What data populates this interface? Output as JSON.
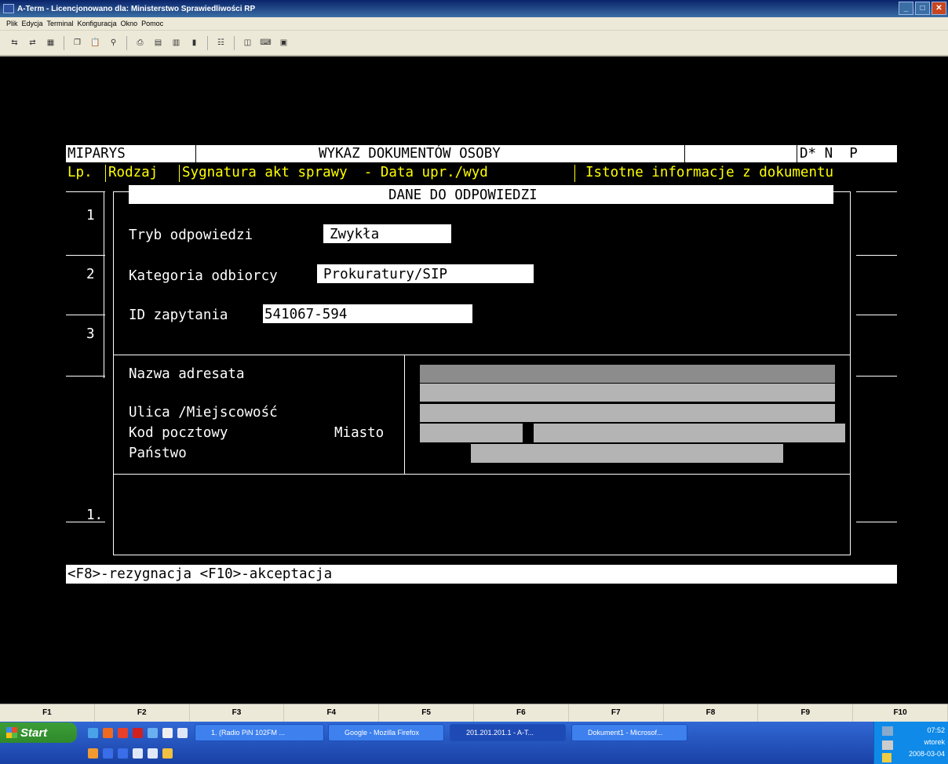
{
  "window": {
    "title": "A-Term - Licencjonowano dla: Ministerstwo Sprawiedliwości RP"
  },
  "menu": [
    "Plik",
    "Edycja",
    "Terminal",
    "Konfiguracja",
    "Okno",
    "Pomoc"
  ],
  "toolbar_icons": [
    "connect-icon",
    "disconnect-icon",
    "screen-icon",
    "copy-icon",
    "paste-icon",
    "find-icon",
    "print-icon",
    "ftp-icon",
    "ftp-download-icon",
    "book-icon",
    "properties-icon",
    "window-icon",
    "keyboard-icon",
    "app-icon"
  ],
  "terminal": {
    "header": {
      "left": "MIPARYS",
      "center": "WYKAZ DOKUMENTÓW OSOBY",
      "right": "D* N  P"
    },
    "columns": "Lp. Rodzaj Sygnatura akt sprawy  - Data upr./wyd  Istotne informacje z dokumentu",
    "columns_parts": {
      "lp": "Lp.",
      "rodzaj": "Rodzaj",
      "sygnatura": "Sygnatura akt sprawy  - Data upr./wyd",
      "istotne": "Istotne informacje z dokumentu"
    },
    "rows": [
      "1",
      "2",
      "3",
      "1."
    ],
    "dialog": {
      "title": "DANE DO ODPOWIEDZI",
      "tryb_label": "Tryb odpowiedzi",
      "tryb_value": "Zwykła",
      "kategoria_label": "Kategoria odbiorcy",
      "kategoria_value": "Prokuratury/SIP",
      "id_label": "ID zapytania",
      "id_value": "541067-594",
      "nazwa_label": "Nazwa adresata",
      "ulica_label": "Ulica /Miejscowość",
      "kod_label": "Kod pocztowy",
      "miasto_label": "Miasto",
      "panstwo_label": "Państwo"
    },
    "footer": "<F8>-rezygnacja <F10>-akceptacja"
  },
  "fkeys": [
    "F1",
    "F2",
    "F3",
    "F4",
    "F5",
    "F6",
    "F7",
    "F8",
    "F9",
    "F10"
  ],
  "taskbar": {
    "start": "Start",
    "buttons": [
      "1. (Radio PiN 102FM ...",
      "Google - Mozilla Firefox",
      "201.201.201.1 - A-T...",
      "Dokument1 - Microsof..."
    ],
    "clock": {
      "time": "07:52",
      "day": "wtorek",
      "date": "2008-03-04"
    }
  }
}
